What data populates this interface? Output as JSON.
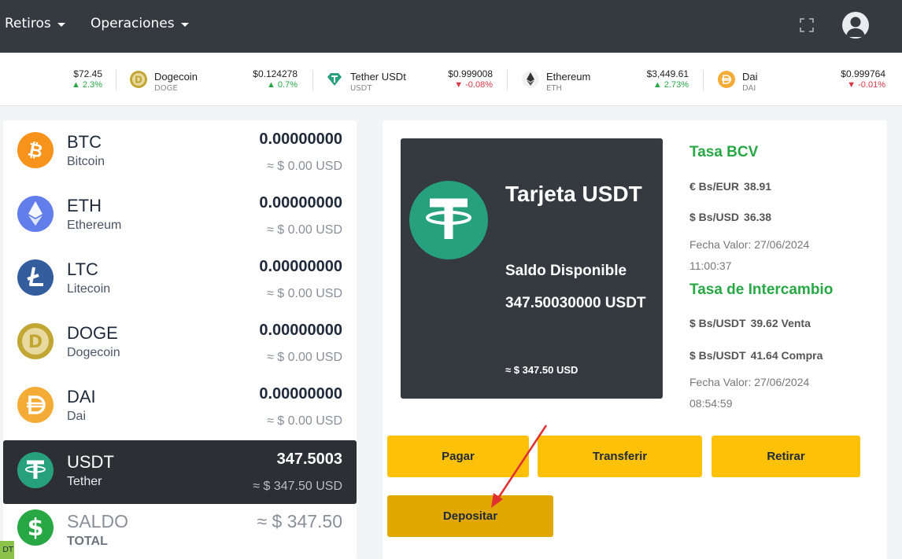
{
  "nav": {
    "items": [
      {
        "label": "Retiros"
      },
      {
        "label": "Operaciones"
      }
    ],
    "expand_icon": "fullscreen-icon",
    "avatar_icon": "user-icon"
  },
  "ticker": {
    "items": [
      {
        "price": "$72.45",
        "change": "2.3%",
        "direction": "up"
      },
      {
        "name": "Dogecoin",
        "symbol": "DOGE",
        "price": "$0.124278",
        "change": "0.7%",
        "direction": "up",
        "icon": "dogecoin-icon"
      },
      {
        "name": "Tether USDt",
        "symbol": "USDT",
        "price": "$0.999008",
        "change": "-0.08%",
        "direction": "down",
        "icon": "tether-gem-icon"
      },
      {
        "name": "Ethereum",
        "symbol": "ETH",
        "price": "$3,449.61",
        "change": "2.73%",
        "direction": "up",
        "icon": "ethereum-icon"
      },
      {
        "name": "Dai",
        "symbol": "DAI",
        "price": "$0.999764",
        "change": "-0.01%",
        "direction": "down",
        "icon": "dai-icon"
      }
    ]
  },
  "wallets": [
    {
      "symbol": "BTC",
      "name": "Bitcoin",
      "amount": "0.00000000",
      "usd": "≈ $ 0.00 USD",
      "color": "#f7931a"
    },
    {
      "symbol": "ETH",
      "name": "Ethereum",
      "amount": "0.00000000",
      "usd": "≈ $ 0.00 USD",
      "color": "#627eea"
    },
    {
      "symbol": "LTC",
      "name": "Litecoin",
      "amount": "0.00000000",
      "usd": "≈ $ 0.00 USD",
      "color": "#345d9d"
    },
    {
      "symbol": "DOGE",
      "name": "Dogecoin",
      "amount": "0.00000000",
      "usd": "≈ $ 0.00 USD",
      "color": "#c2a633"
    },
    {
      "symbol": "DAI",
      "name": "Dai",
      "amount": "0.00000000",
      "usd": "≈ $ 0.00 USD",
      "color": "#f5ac37"
    },
    {
      "symbol": "USDT",
      "name": "Tether",
      "amount": "347.5003",
      "usd": "≈ $ 347.50 USD",
      "color": "#26a17b",
      "active": true
    }
  ],
  "total": {
    "label": "SALDO",
    "sublabel": "TOTAL",
    "value": "≈ $ 347.50",
    "color": "#28a745"
  },
  "card": {
    "title": "Tarjeta USDT",
    "saldo_label": "Saldo Disponible",
    "saldo": "347.50030000 USDT",
    "usd": "≈ $ 347.50 USD"
  },
  "rates": {
    "bcv_title": "Tasa BCV",
    "eur_label": "€ Bs/EUR",
    "eur_value": "38.91",
    "usd_label": "$ Bs/USD",
    "usd_value": "36.38",
    "bcv_date": "Fecha Valor: 27/06/2024 11:00:37",
    "exchange_title": "Tasa de Intercambio",
    "sell_label": "$ Bs/USDT",
    "sell_value": "39.62 Venta",
    "buy_label": "$ Bs/USDT",
    "buy_value": "41.64 Compra",
    "exchange_date": "Fecha Valor: 27/06/2024 08:54:59",
    "accent": "#28a745"
  },
  "actions": {
    "pagar": "Pagar",
    "transferir": "Transferir",
    "retirar": "Retirar",
    "depositar": "Depositar",
    "accent": "#ffc107"
  },
  "corner_tag": "DT"
}
